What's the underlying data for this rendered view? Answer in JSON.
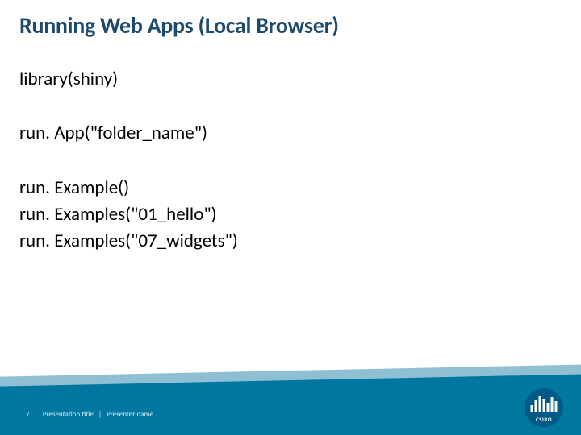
{
  "title": "Running Web Apps (Local Browser)",
  "lines": {
    "l1": "library(shiny)",
    "l2": "run. App(\"folder_name\")",
    "l3": "run. Example()",
    "l4": "run. Examples(\"01_hello\")",
    "l5": "run. Examples(\"07_widgets\")"
  },
  "footer": {
    "page": "7",
    "sep": "|",
    "title": "Presentation title",
    "presenter": "Presenter name"
  },
  "logo": {
    "text": "CSIRO"
  }
}
